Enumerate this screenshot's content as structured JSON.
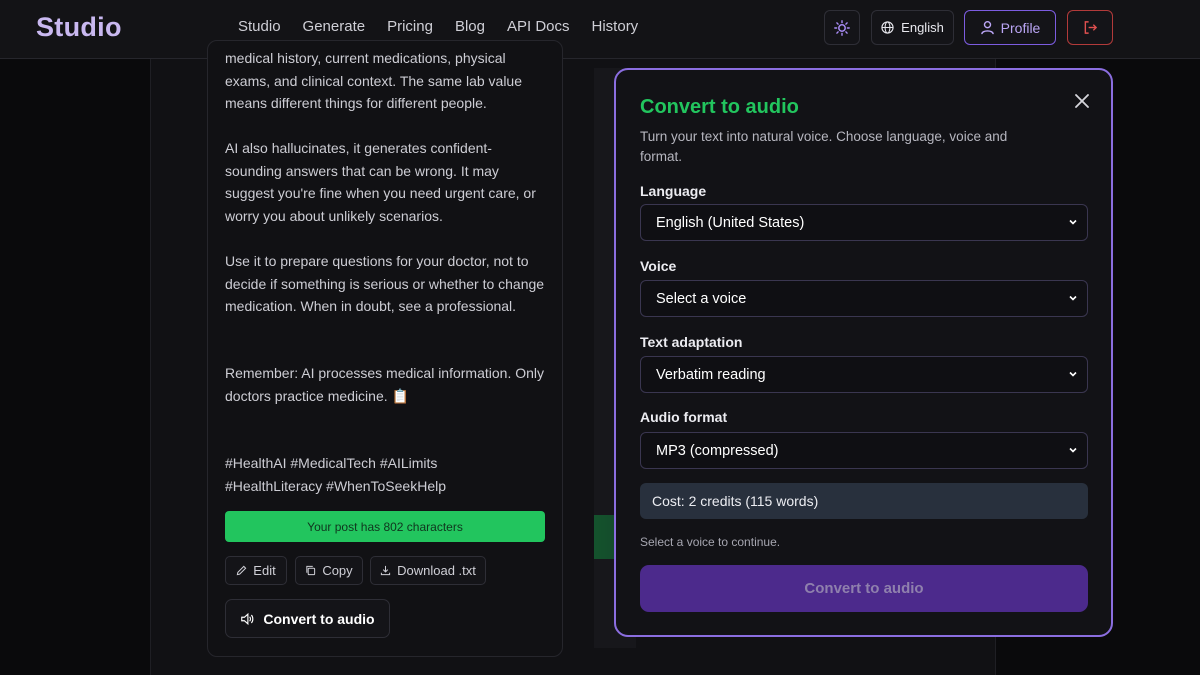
{
  "header": {
    "logo": "Studio",
    "nav": [
      "Studio",
      "Generate",
      "Pricing",
      "Blog",
      "API Docs",
      "History"
    ],
    "language_label": "English",
    "profile_label": "Profile"
  },
  "post": {
    "paragraph_1": "medical history, current medications, physical exams, and clinical context. The same lab value means different things for different people.",
    "paragraph_2": "AI also hallucinates, it generates confident-sounding answers that can be wrong. It may suggest you're fine when you need urgent care, or worry you about unlikely scenarios.",
    "paragraph_3": "Use it to prepare questions for your doctor, not to decide if something is serious or whether to change medication. When in doubt, see a professional.",
    "paragraph_4": "Remember: AI processes medical information. Only doctors practice medicine. 📋",
    "hashtags_1": "#HealthAI #MedicalTech #AILimits",
    "hashtags_2": "#HealthLiteracy #WhenToSeekHelp",
    "char_count_text": "Your post has 802 characters",
    "edit_label": "Edit",
    "copy_label": "Copy",
    "download_label": "Download .txt",
    "convert_label": "Convert to audio"
  },
  "modal": {
    "title": "Convert to audio",
    "subtitle": "Turn your text into natural voice. Choose language, voice and format.",
    "language_label": "Language",
    "language_value": "English (United States)",
    "voice_label": "Voice",
    "voice_value": "Select a voice",
    "adaptation_label": "Text adaptation",
    "adaptation_value": "Verbatim reading",
    "format_label": "Audio format",
    "format_value": "MP3 (compressed)",
    "cost_text": "Cost: 2 credits (115 words)",
    "hint_text": "Select a voice to continue.",
    "submit_label": "Convert to audio"
  },
  "colors": {
    "accent_purple": "#8b6ee0",
    "success_green": "#22c55e",
    "danger_red": "#b23a3a"
  },
  "icons": [
    "sun-icon",
    "globe-icon",
    "user-icon",
    "logout-icon",
    "close-icon",
    "chevron-down-icon",
    "pencil-icon",
    "copy-icon",
    "download-icon",
    "speaker-icon"
  ]
}
